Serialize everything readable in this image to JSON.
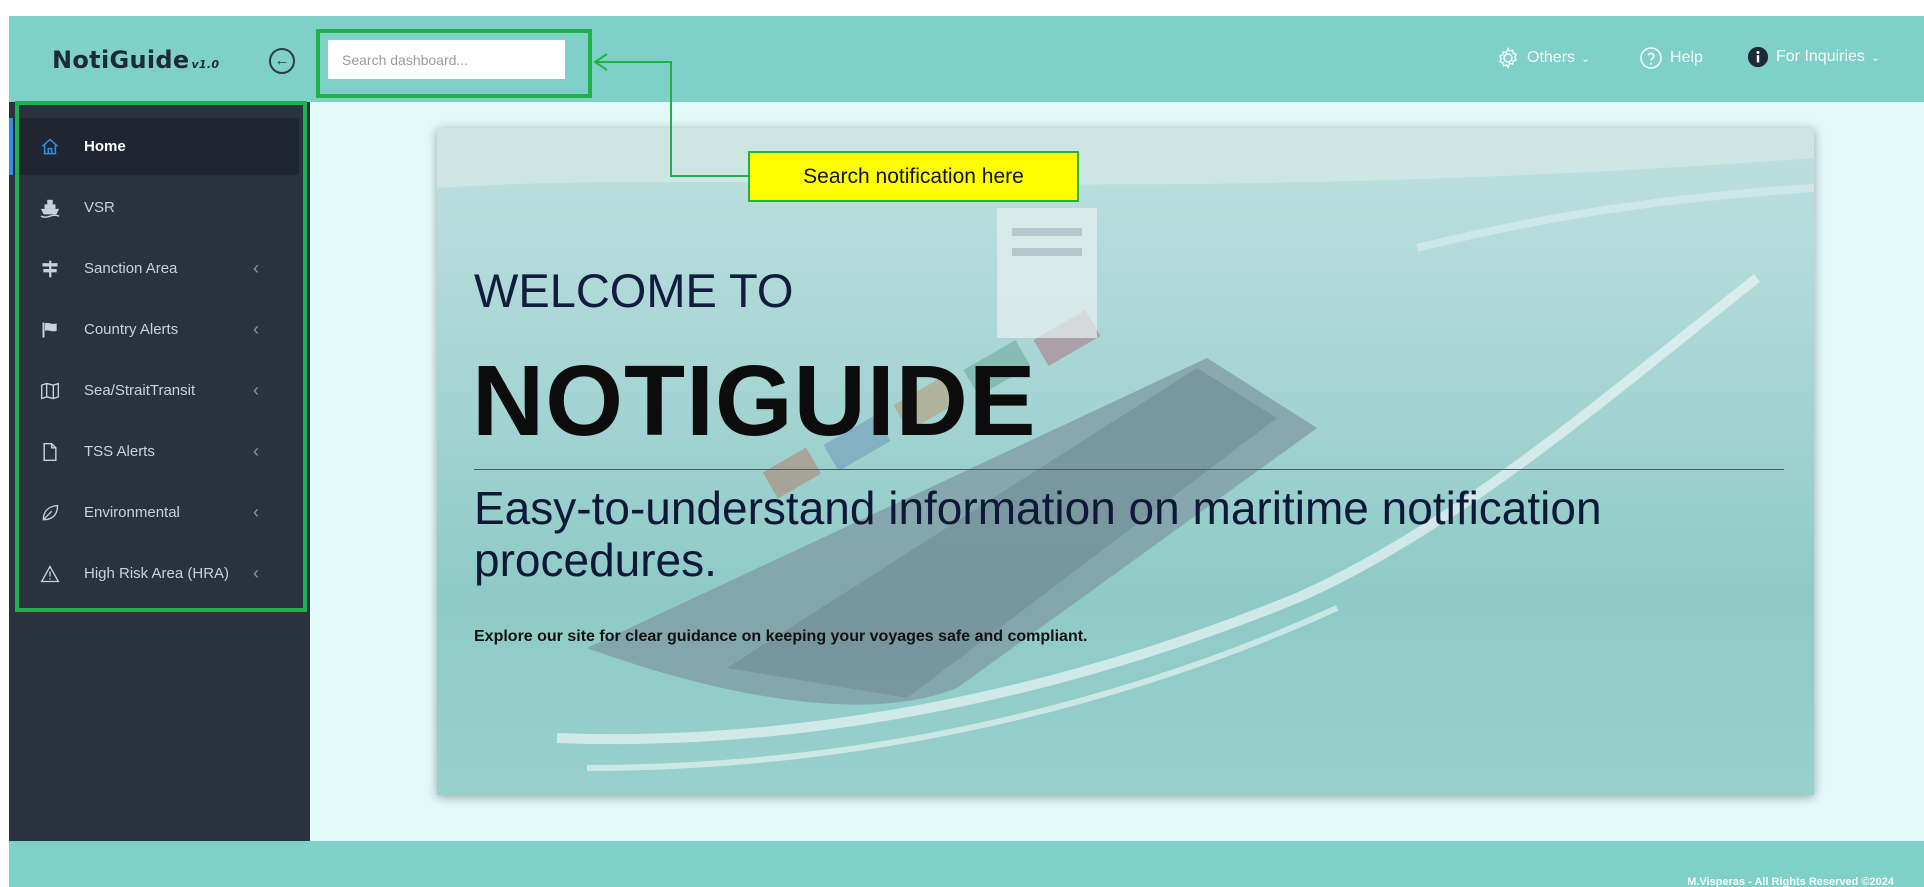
{
  "brand": {
    "name": "NotiGuide",
    "version": "v1.0"
  },
  "search": {
    "placeholder": "Search dashboard..."
  },
  "header_nav": [
    {
      "label": "Others",
      "icon": "gear-icon"
    },
    {
      "label": "Help",
      "icon": "help-circle-icon"
    },
    {
      "label": "For Inquiries",
      "icon": "info-icon"
    }
  ],
  "sidebar": {
    "items": [
      {
        "label": "Home",
        "icon": "home-icon",
        "active": true,
        "has_submenu": false
      },
      {
        "label": "VSR",
        "icon": "ship-icon",
        "active": false,
        "has_submenu": false
      },
      {
        "label": "Sanction Area",
        "icon": "signpost-icon",
        "active": false,
        "has_submenu": true
      },
      {
        "label": "Country Alerts",
        "icon": "flag-icon",
        "active": false,
        "has_submenu": true
      },
      {
        "label": "Sea/StraitTransit",
        "icon": "map-icon",
        "active": false,
        "has_submenu": true
      },
      {
        "label": "TSS Alerts",
        "icon": "document-icon",
        "active": false,
        "has_submenu": true
      },
      {
        "label": "Environmental",
        "icon": "leaf-icon",
        "active": false,
        "has_submenu": true
      },
      {
        "label": "High Risk Area (HRA)",
        "icon": "warning-icon",
        "active": false,
        "has_submenu": true
      }
    ]
  },
  "hero": {
    "welcome": "WELCOME TO",
    "title": "NOTIGUIDE",
    "subtitle": "Easy-to-understand information on maritime notification procedures.",
    "tagline": "Explore our site for clear guidance on keeping your voyages safe and compliant."
  },
  "annotation": {
    "callout": "Search notification here"
  },
  "footer": {
    "copyright": "M.Visperas - All Rights Reserved ©2024"
  },
  "colors": {
    "header": "#7fd0c8",
    "sidebar": "#2a3240",
    "highlight_border": "#1fb24a",
    "callout_fill": "#ffff00",
    "active_accent": "#2f8ee8",
    "page_background": "#e3fafa"
  }
}
